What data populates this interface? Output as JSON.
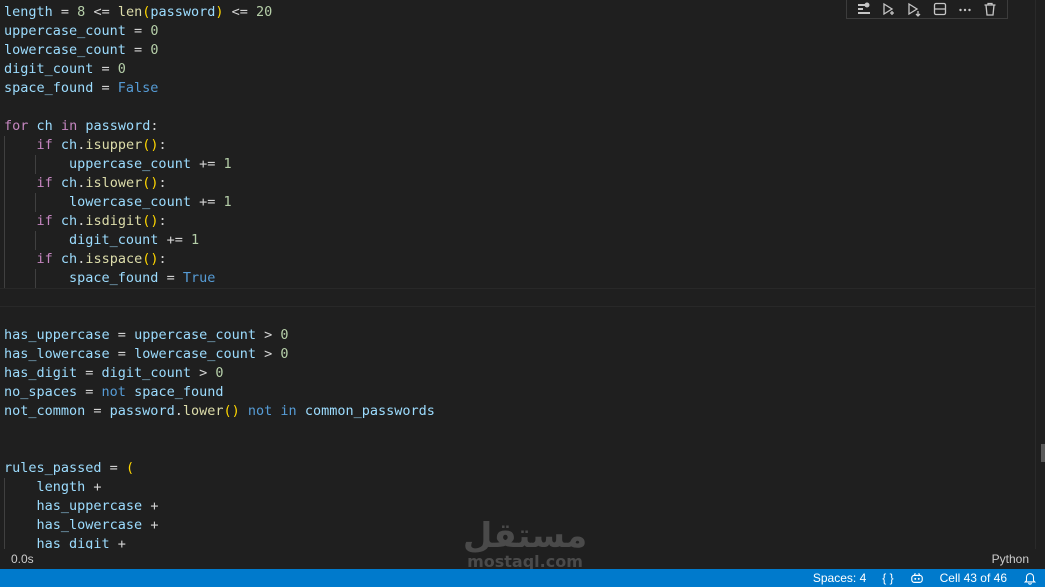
{
  "toolbar": {
    "icons": [
      "run-by-line-icon",
      "execute-above-icon",
      "execute-below-icon",
      "split-cell-icon",
      "more-actions-icon",
      "delete-cell-icon"
    ]
  },
  "code": {
    "lines": [
      [
        [
          "var",
          "length"
        ],
        [
          "op",
          " = "
        ],
        [
          "num",
          "8"
        ],
        [
          "op",
          " <= "
        ],
        [
          "fn",
          "len"
        ],
        [
          "par",
          "("
        ],
        [
          "var",
          "password"
        ],
        [
          "par",
          ")"
        ],
        [
          "op",
          " <= "
        ],
        [
          "num",
          "20"
        ]
      ],
      [
        [
          "var",
          "uppercase_count"
        ],
        [
          "op",
          " = "
        ],
        [
          "num",
          "0"
        ]
      ],
      [
        [
          "var",
          "lowercase_count"
        ],
        [
          "op",
          " = "
        ],
        [
          "num",
          "0"
        ]
      ],
      [
        [
          "var",
          "digit_count"
        ],
        [
          "op",
          " = "
        ],
        [
          "num",
          "0"
        ]
      ],
      [
        [
          "var",
          "space_found"
        ],
        [
          "op",
          " = "
        ],
        [
          "const",
          "False"
        ]
      ],
      [],
      [
        [
          "kw",
          "for"
        ],
        [
          "op",
          " "
        ],
        [
          "var",
          "ch"
        ],
        [
          "op",
          " "
        ],
        [
          "kw",
          "in"
        ],
        [
          "op",
          " "
        ],
        [
          "var",
          "password"
        ],
        [
          "op",
          ":"
        ]
      ],
      [
        [
          "op",
          "    "
        ],
        [
          "kw",
          "if"
        ],
        [
          "op",
          " "
        ],
        [
          "var",
          "ch"
        ],
        [
          "op",
          "."
        ],
        [
          "fn",
          "isupper"
        ],
        [
          "par",
          "()"
        ],
        [
          "op",
          ":"
        ]
      ],
      [
        [
          "op",
          "        "
        ],
        [
          "var",
          "uppercase_count"
        ],
        [
          "op",
          " += "
        ],
        [
          "num",
          "1"
        ]
      ],
      [
        [
          "op",
          "    "
        ],
        [
          "kw",
          "if"
        ],
        [
          "op",
          " "
        ],
        [
          "var",
          "ch"
        ],
        [
          "op",
          "."
        ],
        [
          "fn",
          "islower"
        ],
        [
          "par",
          "()"
        ],
        [
          "op",
          ":"
        ]
      ],
      [
        [
          "op",
          "        "
        ],
        [
          "var",
          "lowercase_count"
        ],
        [
          "op",
          " += "
        ],
        [
          "num",
          "1"
        ]
      ],
      [
        [
          "op",
          "    "
        ],
        [
          "kw",
          "if"
        ],
        [
          "op",
          " "
        ],
        [
          "var",
          "ch"
        ],
        [
          "op",
          "."
        ],
        [
          "fn",
          "isdigit"
        ],
        [
          "par",
          "()"
        ],
        [
          "op",
          ":"
        ]
      ],
      [
        [
          "op",
          "        "
        ],
        [
          "var",
          "digit_count"
        ],
        [
          "op",
          " += "
        ],
        [
          "num",
          "1"
        ]
      ],
      [
        [
          "op",
          "    "
        ],
        [
          "kw",
          "if"
        ],
        [
          "op",
          " "
        ],
        [
          "var",
          "ch"
        ],
        [
          "op",
          "."
        ],
        [
          "fn",
          "isspace"
        ],
        [
          "par",
          "()"
        ],
        [
          "op",
          ":"
        ]
      ],
      [
        [
          "op",
          "        "
        ],
        [
          "var",
          "space_found"
        ],
        [
          "op",
          " = "
        ],
        [
          "const",
          "True"
        ]
      ],
      [],
      [],
      [
        [
          "var",
          "has_uppercase"
        ],
        [
          "op",
          " = "
        ],
        [
          "var",
          "uppercase_count"
        ],
        [
          "op",
          " > "
        ],
        [
          "num",
          "0"
        ]
      ],
      [
        [
          "var",
          "has_lowercase"
        ],
        [
          "op",
          " = "
        ],
        [
          "var",
          "lowercase_count"
        ],
        [
          "op",
          " > "
        ],
        [
          "num",
          "0"
        ]
      ],
      [
        [
          "var",
          "has_digit"
        ],
        [
          "op",
          " = "
        ],
        [
          "var",
          "digit_count"
        ],
        [
          "op",
          " > "
        ],
        [
          "num",
          "0"
        ]
      ],
      [
        [
          "var",
          "no_spaces"
        ],
        [
          "op",
          " = "
        ],
        [
          "const",
          "not"
        ],
        [
          "op",
          " "
        ],
        [
          "var",
          "space_found"
        ]
      ],
      [
        [
          "var",
          "not_common"
        ],
        [
          "op",
          " = "
        ],
        [
          "var",
          "password"
        ],
        [
          "op",
          "."
        ],
        [
          "fn",
          "lower"
        ],
        [
          "par",
          "()"
        ],
        [
          "op",
          " "
        ],
        [
          "const",
          "not"
        ],
        [
          "op",
          " "
        ],
        [
          "const",
          "in"
        ],
        [
          "op",
          " "
        ],
        [
          "var",
          "common_passwords"
        ]
      ],
      [],
      [],
      [
        [
          "var",
          "rules_passed"
        ],
        [
          "op",
          " = "
        ],
        [
          "par",
          "("
        ]
      ],
      [
        [
          "op",
          "    "
        ],
        [
          "var",
          "length"
        ],
        [
          "op",
          " +"
        ]
      ],
      [
        [
          "op",
          "    "
        ],
        [
          "var",
          "has_uppercase"
        ],
        [
          "op",
          " +"
        ]
      ],
      [
        [
          "op",
          "    "
        ],
        [
          "var",
          "has_lowercase"
        ],
        [
          "op",
          " +"
        ]
      ],
      [
        [
          "op",
          "    "
        ],
        [
          "var",
          "has_digit"
        ],
        [
          "op",
          " +"
        ]
      ]
    ]
  },
  "cell_footer": {
    "execution_time": "0.0s",
    "language": "Python"
  },
  "statusbar": {
    "spaces": "Spaces: 4",
    "braces": "{ }",
    "cell_position": "Cell 43 of 46"
  },
  "watermark": {
    "text_arabic": "مستقل",
    "text_latin": "mostaql.com"
  },
  "colors": {
    "background": "#1f1f1f",
    "statusbar": "#007acc",
    "variable": "#9cdcfe",
    "keyword": "#c586c0",
    "function": "#dcdcaa",
    "number": "#b5cea8",
    "constant": "#569cd6",
    "bracket": "#ffd700"
  }
}
